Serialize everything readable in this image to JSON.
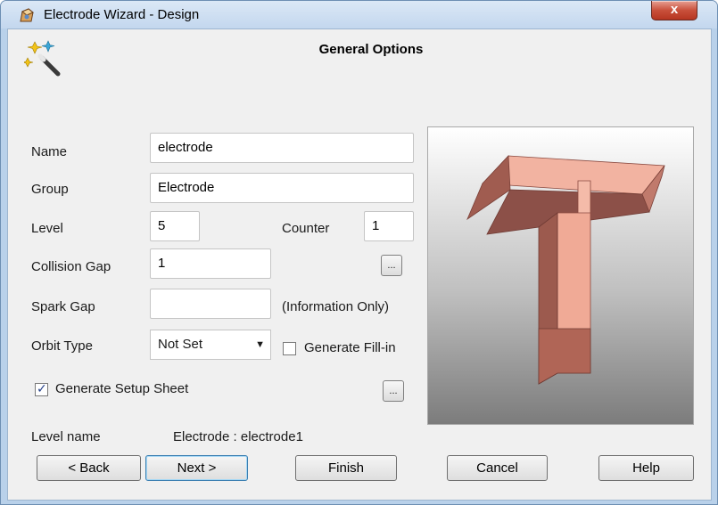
{
  "window": {
    "title": "Electrode Wizard - Design",
    "close_label": "x"
  },
  "page": {
    "heading": "General Options"
  },
  "form": {
    "name_label": "Name",
    "name_value": "electrode",
    "group_label": "Group",
    "group_value": "Electrode",
    "level_label": "Level",
    "level_value": "5",
    "counter_label": "Counter",
    "counter_value": "1",
    "collision_gap_label": "Collision Gap",
    "collision_gap_value": "1",
    "spark_gap_label": "Spark Gap",
    "spark_gap_value": "",
    "spark_gap_note": "(Information Only)",
    "orbit_type_label": "Orbit Type",
    "orbit_type_value": "Not Set",
    "generate_fill_in_label": "Generate Fill-in",
    "generate_fill_in_checked": false,
    "generate_setup_sheet_label": "Generate Setup Sheet",
    "generate_setup_sheet_checked": true,
    "ellipsis_label": "...",
    "level_name_label": "Level name",
    "level_name_value": "Electrode : electrode1"
  },
  "buttons": {
    "back": "< Back",
    "next": "Next >",
    "finish": "Finish",
    "cancel": "Cancel",
    "help": "Help"
  },
  "colors": {
    "electrode_face": "#f0aa96",
    "electrode_side": "#a05c50",
    "close_button": "#c9503b",
    "title_bar": "#c3d7ee"
  }
}
